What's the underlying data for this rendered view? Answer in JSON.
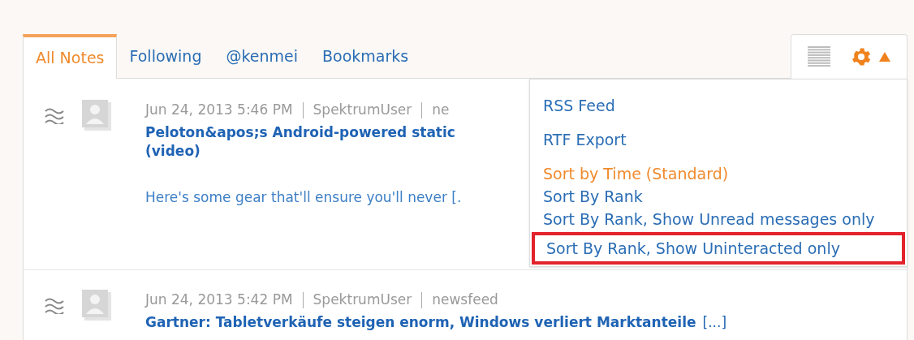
{
  "tabs": [
    {
      "label": "All Notes",
      "selected": true
    },
    {
      "label": "Following",
      "selected": false
    },
    {
      "label": "@kenmei",
      "selected": false
    },
    {
      "label": "Bookmarks",
      "selected": false
    }
  ],
  "menu_open": true,
  "menu": [
    {
      "label": "RSS Feed",
      "kind": "action",
      "selected": false,
      "highlighted": false
    },
    {
      "label": "RTF Export",
      "kind": "action",
      "selected": false,
      "highlighted": false
    },
    {
      "label": "Sort by Time (Standard)",
      "kind": "sort",
      "selected": true,
      "highlighted": false
    },
    {
      "label": "Sort By Rank",
      "kind": "sort",
      "selected": false,
      "highlighted": false
    },
    {
      "label": "Sort By Rank, Show Unread messages only",
      "kind": "sort",
      "selected": false,
      "highlighted": false
    },
    {
      "label": "Sort By Rank, Show Uninteracted only",
      "kind": "sort",
      "selected": false,
      "highlighted": true
    }
  ],
  "notes": [
    {
      "date": "Jun 24, 2013 5:46 PM",
      "author": "SpektrumUser",
      "source": "ne",
      "title": "Peloton&apos;s Android-powered static",
      "title_line2": "(video)",
      "excerpt": "Here's some gear that'll ensure you'll never [."
    },
    {
      "date": "Jun 24, 2013 5:42 PM",
      "author": "SpektrumUser",
      "source": "newsfeed",
      "title": "Gartner: Tabletverkäufe steigen enorm, Windows verliert Marktanteile",
      "more": "[...]"
    }
  ]
}
